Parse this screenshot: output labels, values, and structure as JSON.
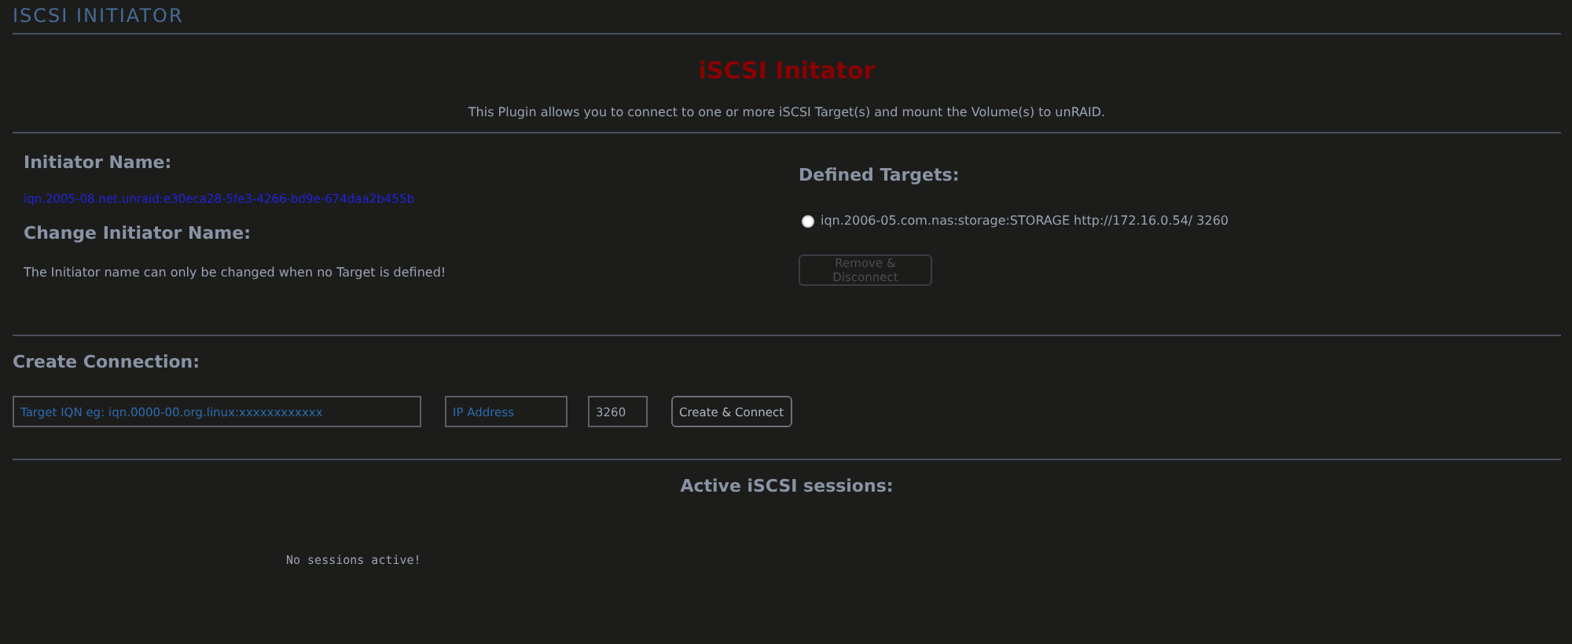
{
  "page_title": "ISCSI INITIATOR",
  "plugin": {
    "title": "iSCSI Initator",
    "description": "This Plugin allows you to connect to one or more iSCSI Target(s) and mount the Volume(s) to unRAID."
  },
  "initiator": {
    "heading": "Initiator Name:",
    "name": "iqn.2005-08.net.unraid:e30eca28-5fe3-4266-bd9e-674daa2b455b",
    "change_heading": "Change Initiator Name:",
    "change_note": "The Initiator name can only be changed when no Target is defined!"
  },
  "targets": {
    "heading": "Defined Targets:",
    "items": [
      {
        "label": "iqn.2006-05.com.nas:storage:STORAGE http://172.16.0.54/ 3260",
        "selected": false
      }
    ],
    "button": {
      "label": "Remove & Disconnect",
      "disabled": true
    }
  },
  "create": {
    "heading": "Create Connection:",
    "iqn_field": {
      "placeholder": "Target IQN eg: iqn.0000-00.org.linux:xxxxxxxxxxxx"
    },
    "ip_field": {
      "placeholder": "IP Address"
    },
    "port_field": {
      "value": "3260"
    },
    "button": {
      "label": "Create & Connect",
      "disabled": false
    }
  },
  "sessions": {
    "heading": "Active iSCSI sessions:",
    "empty": "No sessions active!"
  }
}
